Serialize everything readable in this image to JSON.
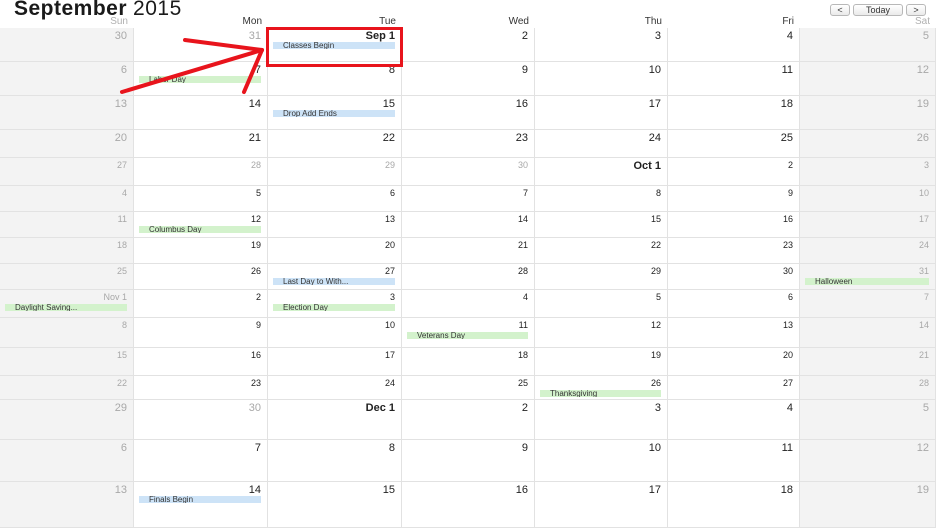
{
  "header": {
    "month": "September",
    "year": "2015",
    "nav": {
      "prev": "<",
      "today": "Today",
      "next": ">"
    }
  },
  "weekdays": [
    "Sun",
    "Mon",
    "Tue",
    "Wed",
    "Thu",
    "Fri",
    "Sat"
  ],
  "weeks": [
    [
      {
        "label": "30",
        "style": "muted"
      },
      {
        "label": "31",
        "style": "muted"
      },
      {
        "label": "Sep 1",
        "style": "bold",
        "events": [
          {
            "title": "Classes Begin",
            "color": "blue"
          }
        ]
      },
      {
        "label": "2"
      },
      {
        "label": "3"
      },
      {
        "label": "4"
      },
      {
        "label": "5"
      }
    ],
    [
      {
        "label": "6"
      },
      {
        "label": "7",
        "events": [
          {
            "title": "Labor Day",
            "color": "green"
          }
        ]
      },
      {
        "label": "8"
      },
      {
        "label": "9"
      },
      {
        "label": "10"
      },
      {
        "label": "11"
      },
      {
        "label": "12"
      }
    ],
    [
      {
        "label": "13"
      },
      {
        "label": "14"
      },
      {
        "label": "15",
        "events": [
          {
            "title": "Drop Add Ends",
            "color": "blue"
          }
        ]
      },
      {
        "label": "16"
      },
      {
        "label": "17"
      },
      {
        "label": "18"
      },
      {
        "label": "19"
      }
    ],
    [
      {
        "label": "20"
      },
      {
        "label": "21"
      },
      {
        "label": "22"
      },
      {
        "label": "23"
      },
      {
        "label": "24"
      },
      {
        "label": "25"
      },
      {
        "label": "26"
      }
    ],
    [
      {
        "label": "27",
        "style": "muted"
      },
      {
        "label": "28",
        "style": "muted"
      },
      {
        "label": "29",
        "style": "muted"
      },
      {
        "label": "30",
        "style": "muted"
      },
      {
        "label": "Oct 1",
        "style": "bold"
      },
      {
        "label": "2"
      },
      {
        "label": "3"
      }
    ],
    [
      {
        "label": "4"
      },
      {
        "label": "5"
      },
      {
        "label": "6"
      },
      {
        "label": "7"
      },
      {
        "label": "8"
      },
      {
        "label": "9"
      },
      {
        "label": "10"
      }
    ],
    [
      {
        "label": "11"
      },
      {
        "label": "12",
        "events": [
          {
            "title": "Columbus Day",
            "color": "green"
          }
        ]
      },
      {
        "label": "13"
      },
      {
        "label": "14"
      },
      {
        "label": "15"
      },
      {
        "label": "16"
      },
      {
        "label": "17"
      }
    ],
    [
      {
        "label": "18"
      },
      {
        "label": "19"
      },
      {
        "label": "20"
      },
      {
        "label": "21"
      },
      {
        "label": "22"
      },
      {
        "label": "23"
      },
      {
        "label": "24"
      }
    ],
    [
      {
        "label": "25"
      },
      {
        "label": "26"
      },
      {
        "label": "27",
        "events": [
          {
            "title": "Last Day to With...",
            "color": "blue"
          }
        ]
      },
      {
        "label": "28"
      },
      {
        "label": "29"
      },
      {
        "label": "30"
      },
      {
        "label": "31",
        "events": [
          {
            "title": "Halloween",
            "color": "green"
          }
        ]
      }
    ],
    [
      {
        "label": "Nov 1",
        "events": [
          {
            "title": "Daylight Saving...",
            "color": "green"
          }
        ]
      },
      {
        "label": "2"
      },
      {
        "label": "3",
        "events": [
          {
            "title": "Election Day",
            "color": "green"
          }
        ]
      },
      {
        "label": "4"
      },
      {
        "label": "5"
      },
      {
        "label": "6"
      },
      {
        "label": "7"
      }
    ],
    [
      {
        "label": "8"
      },
      {
        "label": "9"
      },
      {
        "label": "10"
      },
      {
        "label": "11",
        "events": [
          {
            "title": "Veterans Day",
            "color": "green"
          }
        ]
      },
      {
        "label": "12"
      },
      {
        "label": "13"
      },
      {
        "label": "14"
      }
    ],
    [
      {
        "label": "15"
      },
      {
        "label": "16"
      },
      {
        "label": "17"
      },
      {
        "label": "18"
      },
      {
        "label": "19"
      },
      {
        "label": "20"
      },
      {
        "label": "21"
      }
    ],
    [
      {
        "label": "22"
      },
      {
        "label": "23"
      },
      {
        "label": "24"
      },
      {
        "label": "25"
      },
      {
        "label": "26",
        "events": [
          {
            "title": "Thanksgiving",
            "color": "green"
          }
        ]
      },
      {
        "label": "27"
      },
      {
        "label": "28"
      }
    ],
    [
      {
        "label": "29",
        "style": "muted"
      },
      {
        "label": "30",
        "style": "muted"
      },
      {
        "label": "Dec 1",
        "style": "bold"
      },
      {
        "label": "2"
      },
      {
        "label": "3"
      },
      {
        "label": "4"
      },
      {
        "label": "5"
      }
    ],
    [
      {
        "label": "6"
      },
      {
        "label": "7"
      },
      {
        "label": "8"
      },
      {
        "label": "9"
      },
      {
        "label": "10"
      },
      {
        "label": "11"
      },
      {
        "label": "12"
      }
    ],
    [
      {
        "label": "13"
      },
      {
        "label": "14",
        "events": [
          {
            "title": "Finals Begin",
            "color": "blue"
          }
        ]
      },
      {
        "label": "15"
      },
      {
        "label": "16"
      },
      {
        "label": "17"
      },
      {
        "label": "18"
      },
      {
        "label": "19"
      }
    ]
  ],
  "colors": {
    "annotation": "#e8141c",
    "event_blue": "#cde3f7",
    "event_green": "#d3f2cc",
    "weekend_bg": "#f3f3f3"
  }
}
